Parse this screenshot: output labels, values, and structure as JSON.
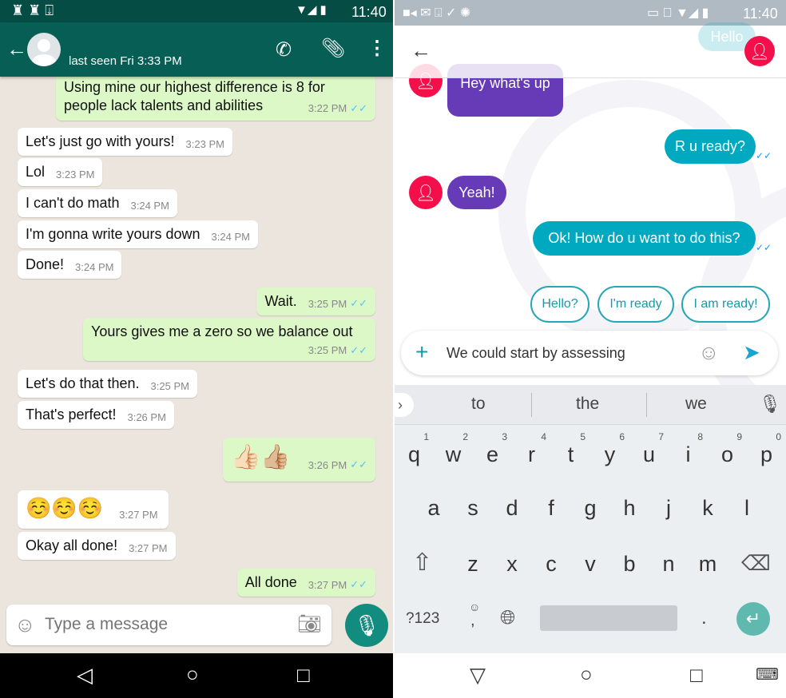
{
  "whatsapp": {
    "status_time": "11:40",
    "header": {
      "last_seen": "last seen Fri 3:33 PM"
    },
    "messages": [
      {
        "dir": "out",
        "text": "Using mine our highest difference is 8 for people lack talents and abilities",
        "time": "3:22 PM"
      },
      {
        "dir": "in",
        "text": "Let's just go with yours!",
        "time": "3:23 PM"
      },
      {
        "dir": "in",
        "text": "Lol",
        "time": "3:23 PM"
      },
      {
        "dir": "in",
        "text": "I can't do math",
        "time": "3:24 PM"
      },
      {
        "dir": "in",
        "text": "I'm gonna write yours down",
        "time": "3:24 PM"
      },
      {
        "dir": "in",
        "text": "Done!",
        "time": "3:24 PM"
      },
      {
        "dir": "out",
        "text": "Wait.",
        "time": "3:25 PM"
      },
      {
        "dir": "out",
        "text": "Yours gives me a zero so we balance out",
        "time": "3:25 PM"
      },
      {
        "dir": "in",
        "text": "Let's do that then.",
        "time": "3:25 PM"
      },
      {
        "dir": "in",
        "text": "That's perfect!",
        "time": "3:26 PM"
      },
      {
        "dir": "out",
        "text": "👍🏻👍🏼",
        "time": "3:26 PM"
      },
      {
        "dir": "in",
        "text": "☺️☺️☺️",
        "time": "3:27 PM"
      },
      {
        "dir": "in",
        "text": "Okay all done!",
        "time": "3:27 PM"
      },
      {
        "dir": "out",
        "text": "All done",
        "time": "3:27 PM"
      }
    ],
    "input_placeholder": "Type a message",
    "colors": {
      "header": "#075e54",
      "outgoing": "#dcf8c6",
      "mic": "#128c7e"
    }
  },
  "allo": {
    "status_time": "11:40",
    "messages": [
      {
        "dir": "out",
        "text": "Hello"
      },
      {
        "dir": "in",
        "text": "Hey what's up"
      },
      {
        "dir": "out",
        "text": "R u ready?"
      },
      {
        "dir": "in",
        "text": "Yeah!"
      },
      {
        "dir": "out",
        "text": "Ok! How do u want to do this?"
      }
    ],
    "smart_replies": [
      "Hello?",
      "I'm ready",
      "I am ready!"
    ],
    "input_value": "We could start by assessing",
    "suggestions": [
      "to",
      "the",
      "we"
    ],
    "keyboard": {
      "row1": [
        "q",
        "w",
        "e",
        "r",
        "t",
        "y",
        "u",
        "i",
        "o",
        "p"
      ],
      "row1_hints": [
        "1",
        "2",
        "3",
        "4",
        "5",
        "6",
        "7",
        "8",
        "9",
        "0"
      ],
      "row2": [
        "a",
        "s",
        "d",
        "f",
        "g",
        "h",
        "j",
        "k",
        "l"
      ],
      "row3": [
        "z",
        "x",
        "c",
        "v",
        "b",
        "n",
        "m"
      ],
      "symbols": "?123",
      "comma": ",",
      "period": "."
    },
    "colors": {
      "incoming": "#673ab7",
      "outgoing": "#00a9c0",
      "avatar": "#f50f4a"
    }
  }
}
